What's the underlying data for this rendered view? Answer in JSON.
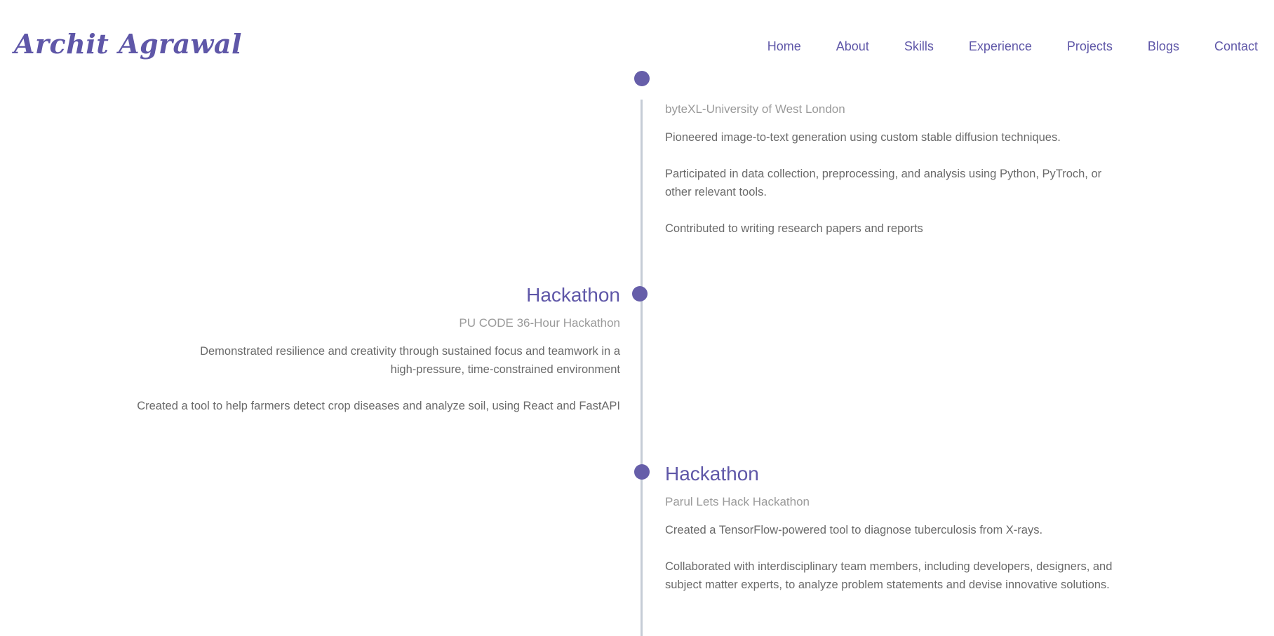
{
  "header": {
    "logo": "Archit Agrawal",
    "nav": [
      {
        "label": "Home"
      },
      {
        "label": "About"
      },
      {
        "label": "Skills"
      },
      {
        "label": "Experience"
      },
      {
        "label": "Projects"
      },
      {
        "label": "Blogs"
      },
      {
        "label": "Contact"
      }
    ]
  },
  "colors": {
    "accent": "#5f57a8",
    "timeline_dot": "#665ea9",
    "timeline_line": "#c5ccd6",
    "muted_text": "#9a9a9a",
    "body_text": "#6a6a6a"
  },
  "timeline": {
    "entries": [
      {
        "title": "",
        "org": "byteXL-University of West London",
        "points": [
          "Pioneered image-to-text generation using custom stable diffusion techniques.",
          "Participated in data collection, preprocessing, and analysis using Python, PyTroch, or other relevant tools.",
          "Contributed to writing research papers and reports"
        ]
      },
      {
        "title": "Hackathon",
        "org": "PU CODE 36-Hour Hackathon",
        "points": [
          "Demonstrated resilience and creativity through sustained focus and teamwork in a high-pressure, time-constrained environment",
          "Created a tool to help farmers detect crop diseases and analyze soil, using React and FastAPI"
        ]
      },
      {
        "title": "Hackathon",
        "org": "Parul Lets Hack Hackathon",
        "points": [
          "Created a TensorFlow-powered tool to diagnose tuberculosis from X-rays.",
          "Collaborated with interdisciplinary team members, including developers, designers, and subject matter experts, to analyze problem statements and devise innovative solutions."
        ]
      }
    ]
  }
}
